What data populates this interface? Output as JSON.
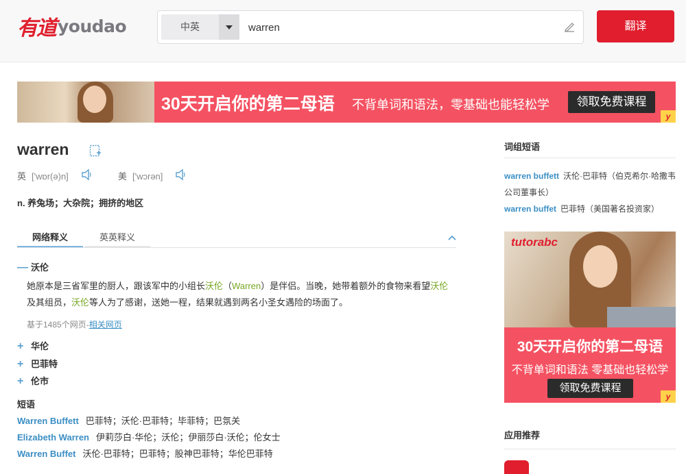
{
  "header": {
    "logo_cn": "有道",
    "logo_en": "youdao",
    "lang_select": "中英",
    "search_value": "warren",
    "translate_button": "翻译"
  },
  "banner_top": {
    "title": "30天开启你的第二母语",
    "subtitle": "不背单词和语法，零基础也能轻松学",
    "cta": "领取免费课程",
    "corner": "y"
  },
  "word": {
    "title": "warren",
    "uk_label": "英",
    "uk_phonetic": "['wɒr(ə)n]",
    "us_label": "美",
    "us_phonetic": "['wɔrən]",
    "basic_def": "n. 养兔场；大杂院；拥挤的地区"
  },
  "tabs": [
    {
      "label": "网络释义"
    },
    {
      "label": "英英释义"
    }
  ],
  "web_defs": {
    "expanded": {
      "symbol": "—",
      "term": "沃伦",
      "example_part1": "她原本是三省军里的厨人，跟该军中的小组长",
      "example_hl1": "沃伦",
      "example_part2": "（",
      "example_hl2": "Warren",
      "example_part3": "）是伴侣。当晚，她带着额外的食物来看望",
      "example_hl3": "沃伦",
      "example_part4": "及其组员，",
      "example_hl4": "沃伦",
      "example_part5": "等人为了感谢，送她一程，结果就遇到两名小圣女遇险的场面了。",
      "note": "基于1485个网页-",
      "note_link": "相关网页"
    },
    "collapsed": [
      {
        "symbol": "+",
        "term": "华伦"
      },
      {
        "symbol": "+",
        "term": "巴菲特"
      },
      {
        "symbol": "+",
        "term": "伦市"
      }
    ]
  },
  "phrases": {
    "title": "短语",
    "items": [
      {
        "en": "Warren Buffett",
        "cn": "巴菲特；沃伦·巴菲特；毕菲特；巴氛关"
      },
      {
        "en": "Elizabeth Warren",
        "cn": "伊莉莎白·华伦；沃伦；伊丽莎白·沃伦；伦女士"
      },
      {
        "en": "Warren Buffet",
        "cn": "沃伦·巴菲特；巴菲特；股神巴菲特；华伦巴菲特"
      }
    ]
  },
  "sidebar": {
    "phrase_title": "词组短语",
    "phrases": [
      {
        "en": "warren buffett",
        "cn": "沃伦·巴菲特（伯克希尔·哈撒韦公司董事长）"
      },
      {
        "en": "warren buffet",
        "cn": "巴菲特（美国著名投资家）"
      }
    ],
    "ad": {
      "brand": "tutorabc",
      "title": "30天开启你的第二母语",
      "subtitle": "不背单词和语法  零基础也轻松学",
      "cta": "领取免费课程",
      "corner": "y"
    },
    "apps_title": "应用推荐"
  },
  "colors": {
    "brand_red": "#e01e2e",
    "banner_red": "#f45262",
    "link_blue": "#3b8ec4",
    "highlight_green": "#76a722"
  }
}
